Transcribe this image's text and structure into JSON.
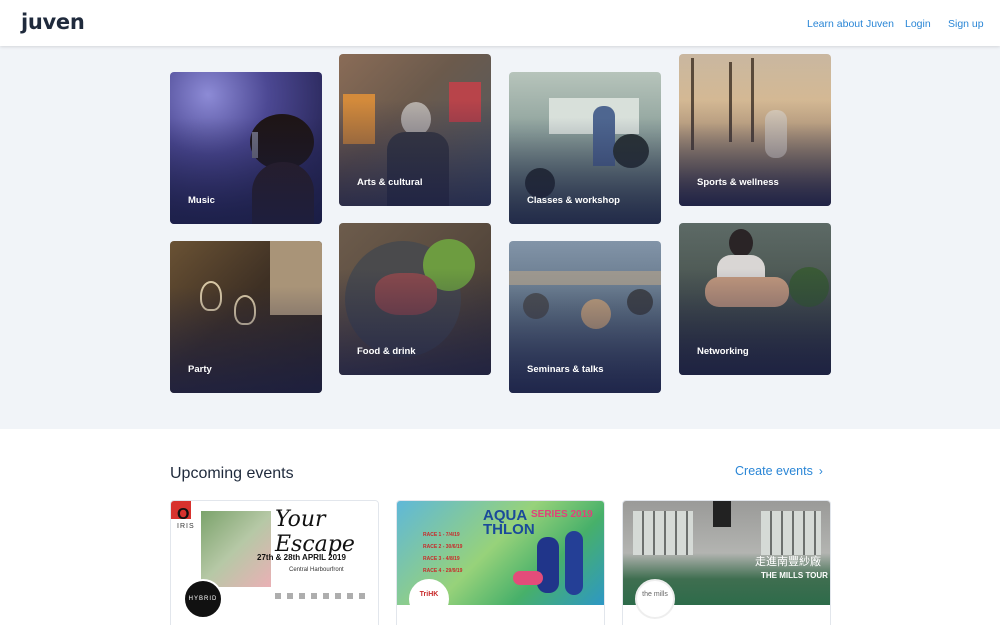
{
  "header": {
    "logo": "juven",
    "nav": {
      "learn": "Learn about Juven",
      "login": "Login",
      "signup": "Sign up"
    }
  },
  "categories": [
    {
      "label": "Music"
    },
    {
      "label": "Arts & cultural"
    },
    {
      "label": "Classes & workshop"
    },
    {
      "label": "Sports & wellness"
    },
    {
      "label": "Party"
    },
    {
      "label": "Food & drink"
    },
    {
      "label": "Seminars & talks"
    },
    {
      "label": "Networking"
    }
  ],
  "upcoming": {
    "title": "Upcoming events",
    "create_label": "Create events",
    "events": [
      {
        "headline": "Your Escape",
        "brand": "IRIS",
        "date_line": "27th & 28th APRIL 2019",
        "venue_line": "Central Harbourfront",
        "badge": "HYBRID"
      },
      {
        "headline_1": "AQUA",
        "headline_series": "SERIES 2019",
        "headline_2": "THLON",
        "races": [
          "RACE 1 - 7/4/19",
          "RACE 2 - 30/6/19",
          "RACE 3 - 4/8/19",
          "RACE 4 - 29/9/19"
        ],
        "badge": "TriHK"
      },
      {
        "headline_cn": "走進南豐紗廠",
        "headline_en": "THE MILLS TOUR",
        "badge": "the mills"
      }
    ]
  },
  "colors": {
    "accent": "#2a86d6",
    "page_bg": "#f1f4f8"
  }
}
